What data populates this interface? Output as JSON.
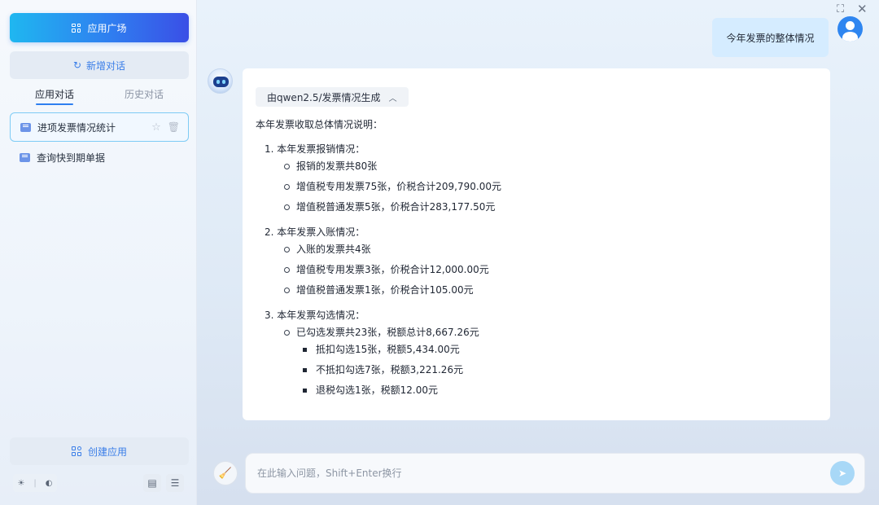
{
  "sidebar": {
    "app_square_label": "应用广场",
    "new_chat_label": "新增对话",
    "tabs": [
      {
        "label": "应用对话"
      },
      {
        "label": "历史对话"
      }
    ],
    "conversations": [
      {
        "label": "进项发票情况统计"
      },
      {
        "label": "查询快到期单据"
      }
    ],
    "create_app_label": "创建应用"
  },
  "chat": {
    "user_message": "今年发票的整体情况",
    "model_tag": "由qwen2.5/发票情况生成",
    "intro": "本年发票收取总体情况说明：",
    "sections": [
      {
        "title": "1. 本年发票报销情况：",
        "items": [
          "报销的发票共80张",
          "增值税专用发票75张，价税合计209,790.00元",
          "增值税普通发票5张，价税合计283,177.50元"
        ]
      },
      {
        "title": "2. 本年发票入账情况：",
        "items": [
          "入账的发票共4张",
          "增值税专用发票3张，价税合计12,000.00元",
          "增值税普通发票1张，价税合计105.00元"
        ]
      },
      {
        "title": "3. 本年发票勾选情况：",
        "items": [
          "已勾选发票共23张，税额总计8,667.26元"
        ],
        "subitems": [
          "抵扣勾选15张，税额5,434.00元",
          "不抵扣勾选7张，税额3,221.26元",
          "退税勾选1张，税额12.00元"
        ]
      }
    ]
  },
  "input": {
    "placeholder": "在此输入问题，Shift+Enter换行"
  },
  "colors": {
    "accent": "#2f7ff0",
    "user_bubble": "#d5ecff",
    "send_button": "#a8d8f7"
  }
}
